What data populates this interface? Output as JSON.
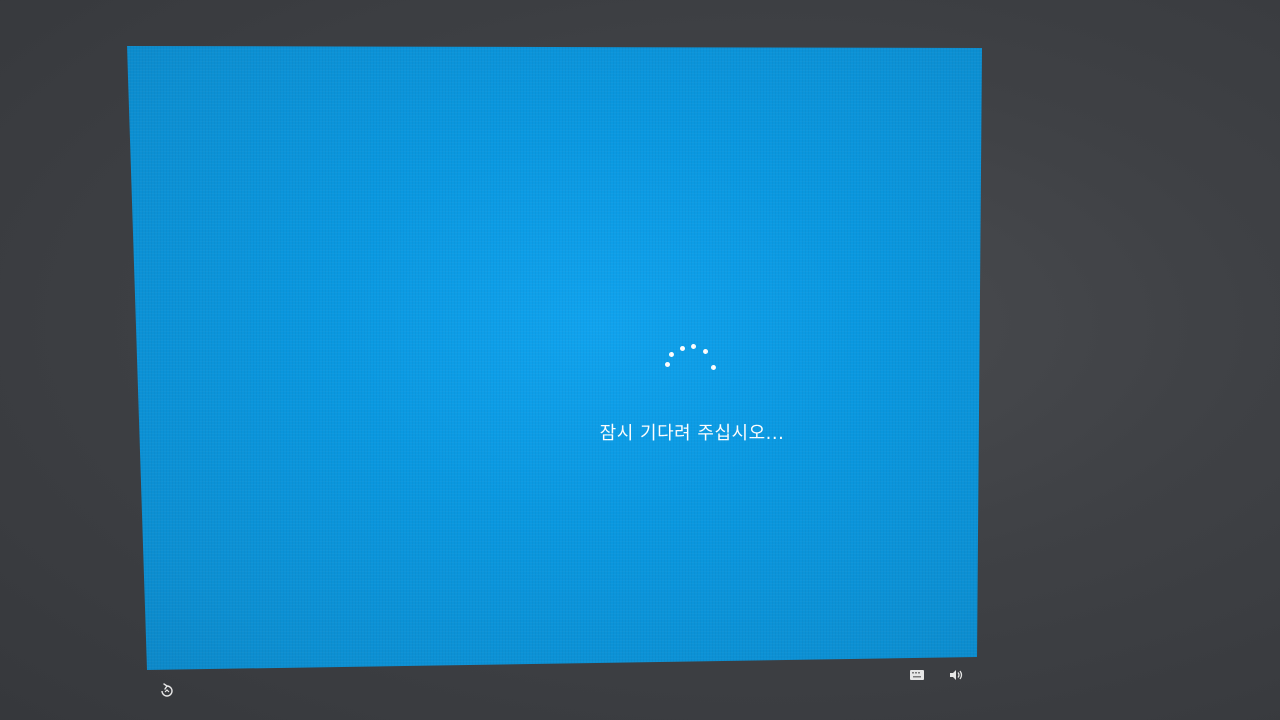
{
  "screen": {
    "status_message": "잠시 기다려 주십시오...",
    "background_color": "#0a98e0",
    "text_color": "#ffffff"
  },
  "spinner": {
    "icon": "loading-dots-spinner",
    "dot_count": 6
  },
  "bottom_bar": {
    "left_icons": [
      "ease-of-access-icon"
    ],
    "right_icons": [
      "keyboard-icon",
      "volume-icon"
    ]
  }
}
